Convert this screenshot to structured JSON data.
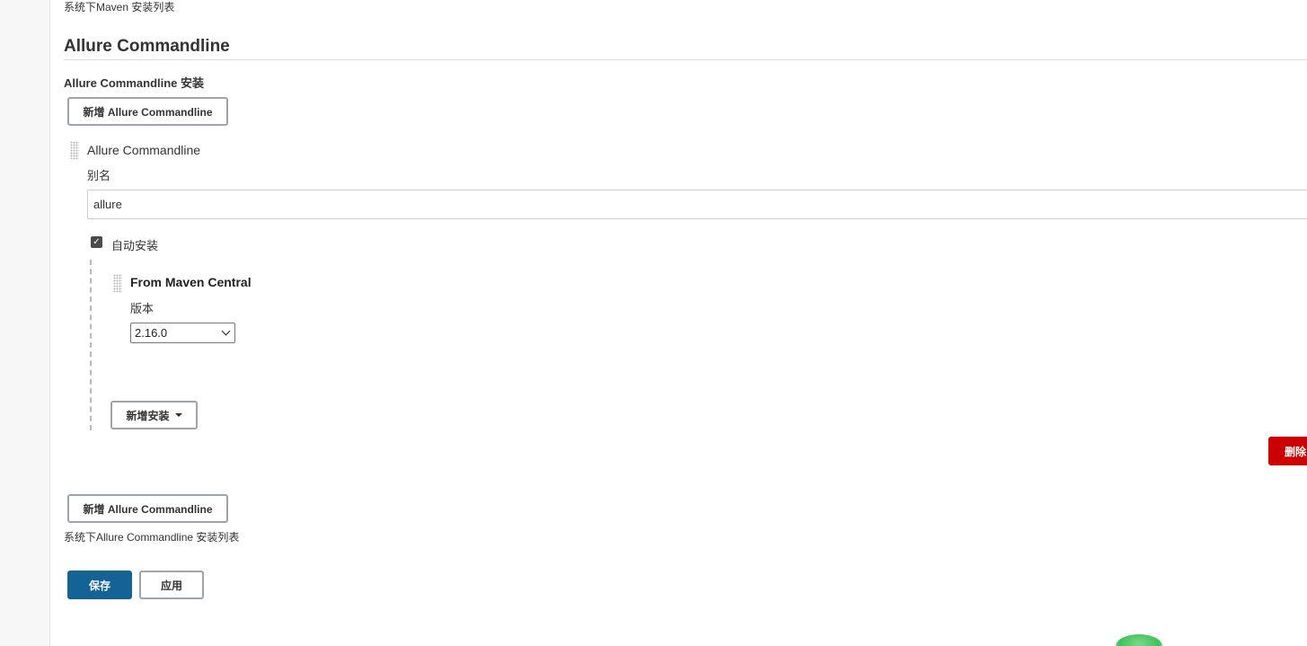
{
  "maven_section": {
    "list_note": "系统下Maven 安装列表"
  },
  "allure_section": {
    "title": "Allure Commandline",
    "subtitle": "Allure Commandline 安装",
    "add_button_label": "新增 Allure Commandline",
    "installation": {
      "name": "Allure Commandline",
      "alias_label": "别名",
      "alias_value": "allure",
      "auto_install_label": "自动安装",
      "auto_install_checked": true,
      "installer": {
        "title": "From Maven Central",
        "version_label": "版本",
        "version_selected": "2.16.0"
      },
      "add_installer_label": "新增安装",
      "delete_label": "删除"
    },
    "add_button_bottom_label": "新增 Allure Commandline",
    "list_note": "系统下Allure Commandline 安装列表"
  },
  "footer": {
    "save_label": "保存",
    "apply_label": "应用"
  },
  "colors": {
    "primary": "#136397",
    "danger": "#cc0000",
    "border": "#9aa5b1"
  }
}
